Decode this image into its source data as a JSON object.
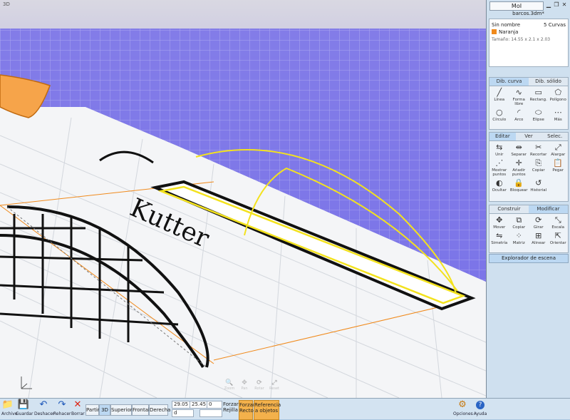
{
  "viewport": {
    "label": "3D"
  },
  "app": {
    "title": "MoI",
    "document": "barcos.3dm*",
    "min_icon": "▁",
    "restore_icon": "❐",
    "close_icon": "✕"
  },
  "properties": {
    "name": "Sin nombre",
    "count": "5 Curvas",
    "style": "Naranja",
    "style_color": "#f08a1c",
    "size": "Tamaño: 14.55 x 2.1 x 2.03"
  },
  "draw_tabs": [
    "Dib. curva",
    "Dib. sólido"
  ],
  "draw_tools": [
    {
      "icon": "╱",
      "label": "Línea"
    },
    {
      "icon": "∿",
      "label": "Forma libre"
    },
    {
      "icon": "▭",
      "label": "Rectang."
    },
    {
      "icon": "⬠",
      "label": "Polígono"
    },
    {
      "icon": "○",
      "label": "Círculo"
    },
    {
      "icon": "◜",
      "label": "Arco"
    },
    {
      "icon": "⬭",
      "label": "Elipse"
    },
    {
      "icon": "⋯",
      "label": "Más"
    }
  ],
  "edit_tabs": [
    "Editar",
    "Ver",
    "Selec."
  ],
  "edit_tools": [
    {
      "icon": "⇆",
      "label": "Unir"
    },
    {
      "icon": "⇹",
      "label": "Separar"
    },
    {
      "icon": "✂",
      "label": "Recortar"
    },
    {
      "icon": "⤢",
      "label": "Alargar"
    },
    {
      "icon": "⋰",
      "label": "Mostrar puntos"
    },
    {
      "icon": "✛",
      "label": "Añadir puntos"
    },
    {
      "icon": "⎘",
      "label": "Copiar"
    },
    {
      "icon": "📋",
      "label": "Pegar"
    },
    {
      "icon": "◐",
      "label": "Ocultar"
    },
    {
      "icon": "🔒",
      "label": "Bloquear"
    },
    {
      "icon": "↺",
      "label": "Historial"
    }
  ],
  "transform_tabs": [
    "Construir",
    "Modificar"
  ],
  "transform_tools": [
    {
      "icon": "✥",
      "label": "Mover"
    },
    {
      "icon": "⧉",
      "label": "Copiar"
    },
    {
      "icon": "⟳",
      "label": "Girar"
    },
    {
      "icon": "⤡",
      "label": "Escala"
    },
    {
      "icon": "⇋",
      "label": "Simetría"
    },
    {
      "icon": "⁘",
      "label": "Matriz"
    },
    {
      "icon": "⊞",
      "label": "Alinear"
    },
    {
      "icon": "⇱",
      "label": "Orientar"
    }
  ],
  "scene_browser": "Explorador de escena",
  "toolbar": {
    "file_icon": "📁",
    "file": "Archivo",
    "save_icon": "💾",
    "save": "Guardar",
    "undo_icon": "↶",
    "undo": "Deshacer",
    "redo_icon": "↷",
    "redo": "Rehacer",
    "delete_icon": "✕",
    "delete": "Borrar",
    "views": [
      "Partir",
      "3D",
      "Superior",
      "Frontal",
      "Derecha"
    ],
    "coord_x": "29.05",
    "coord_y": "25.45",
    "coord_z": "0",
    "coord_d": "d",
    "grid_snap": "Forzar Rejilla",
    "straight_snap": "Forzar Recto",
    "object_snap": "Referencia a objetos",
    "options_icon": "⚙",
    "options": "Opciones",
    "help_icon": "?",
    "help": "Ayuda"
  },
  "nav_overlay": {
    "zoom_icon": "🔍",
    "pan_icon": "✥",
    "rotate_icon": "⟳",
    "reset_icon": "⤢",
    "zoom": "Zoom",
    "pan": "Pan",
    "rotate": "Rotar",
    "reset": "Reset"
  }
}
